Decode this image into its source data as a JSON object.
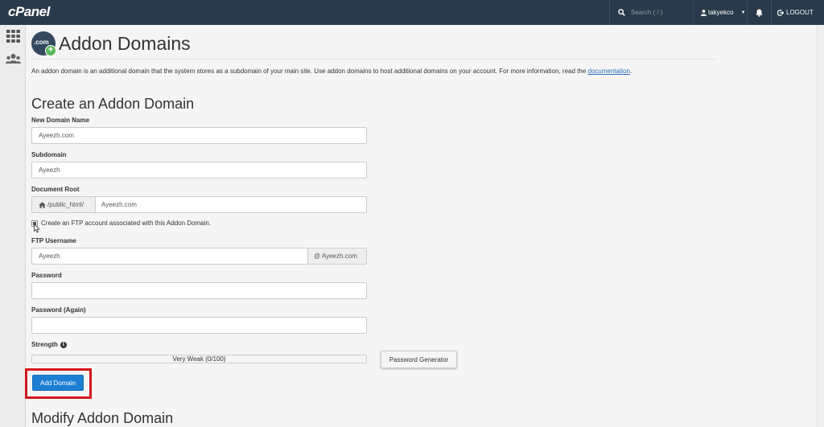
{
  "topbar": {
    "logo": "cPanel",
    "search_placeholder": "Search ( / )",
    "username": "takyekco",
    "logout_label": "LOGOUT"
  },
  "page": {
    "title": "Addon Domains",
    "icon_text": ".com",
    "intro_text": "An addon domain is an additional domain that the system stores as a subdomain of your main site. Use addon domains to host additional domains on your account. For more information, read the ",
    "intro_link": "documentation",
    "intro_end": "."
  },
  "create": {
    "section_title": "Create an Addon Domain",
    "new_domain_label": "New Domain Name",
    "new_domain_value": "Ayeezh.com",
    "subdomain_label": "Subdomain",
    "subdomain_value": "Ayeezh",
    "docroot_label": "Document Root",
    "docroot_prefix": "/public_html/",
    "docroot_value": "Ayeezh.com",
    "ftp_checkbox_label": "Create an FTP account associated with this Addon Domain.",
    "ftp_checked": true,
    "ftp_username_label": "FTP Username",
    "ftp_username_value": "Ayeezh",
    "ftp_username_suffix": "@ Ayeezh.com",
    "password_label": "Password",
    "password_value": "",
    "password_again_label": "Password (Again)",
    "password_again_value": "",
    "strength_label": "Strength",
    "strength_text": "Very Weak (0/100)",
    "strength_score": 0,
    "password_generator_label": "Password Generator",
    "add_button_label": "Add Domain"
  },
  "modify": {
    "section_title": "Modify Addon Domain"
  },
  "colors": {
    "topbar": "#293a4a",
    "primary_button": "#1d7fd3",
    "highlight": "#d3161e",
    "link": "#2a72b5"
  }
}
